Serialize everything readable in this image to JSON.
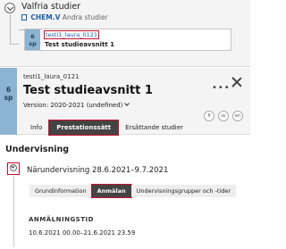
{
  "tree": {
    "title": "Valfria studier",
    "parent_code": "CHEM.V",
    "parent_name": "Andra studier",
    "item": {
      "credits": "6",
      "unit": "sp",
      "code": "testi1_laura_0121",
      "name": "Test studieavsnitt 1"
    }
  },
  "detail": {
    "credits": "6",
    "unit": "sp",
    "code": "testi1_laura_0121",
    "title": "Test studieavsnitt 1",
    "version": "Version: 2020-2021 (undefined)",
    "more": "•••",
    "languages": [
      "fi",
      "sv",
      "en"
    ],
    "tabs": [
      {
        "label": "Info",
        "active": false
      },
      {
        "label": "Prestationssätt",
        "active": true
      },
      {
        "label": "Ersättande studier",
        "active": false
      }
    ]
  },
  "teaching": {
    "heading": "Undervisning",
    "event": "Närundervisning 28.6.2021–9.7.2021",
    "subtabs": [
      {
        "label": "Grundinformation",
        "active": false
      },
      {
        "label": "Anmälan",
        "active": true
      },
      {
        "label": "Undervisningsgrupper och -tider",
        "active": false
      }
    ],
    "enrollment_heading": "ANMÄLNINGSTID",
    "enrollment_period": "10.6.2021 00.00–21.6.2021 23.59"
  },
  "colors": {
    "stripe": "#8cb3d1",
    "highlight": "#c8102e",
    "active_tab": "#444444",
    "link": "#1a5fa8"
  }
}
